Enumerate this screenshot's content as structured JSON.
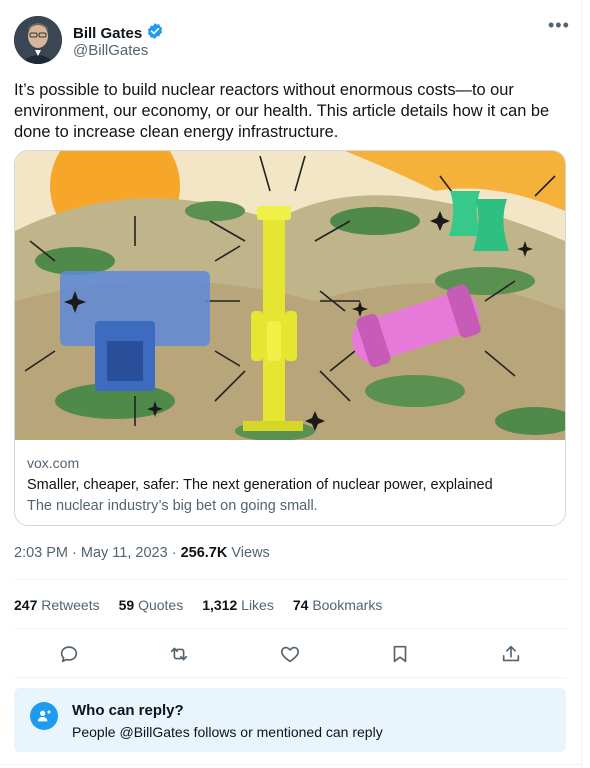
{
  "author": {
    "name": "Bill Gates",
    "handle": "@BillGates",
    "verified_color": "#1d9bf0"
  },
  "tweet": {
    "text": "It’s possible to build nuclear reactors without enormous costs—to our environment, our economy, or our health. This article details how it can be done to increase clean energy infrastructure."
  },
  "card": {
    "image_icon": "nuclear-reactors-illustration",
    "domain": "vox.com",
    "title": "Smaller, cheaper, safer: The next generation of nuclear power, explained",
    "description": "The nuclear industry’s big bet on going small."
  },
  "meta": {
    "time": "2:03 PM",
    "date": "May 11, 2023",
    "views_count": "256.7K",
    "views_label": "Views"
  },
  "stats": [
    {
      "count": "247",
      "label": "Retweets"
    },
    {
      "count": "59",
      "label": "Quotes"
    },
    {
      "count": "1,312",
      "label": "Likes"
    },
    {
      "count": "74",
      "label": "Bookmarks"
    }
  ],
  "actions": [
    "reply-icon",
    "retweet-icon",
    "like-icon",
    "bookmark-icon",
    "share-icon"
  ],
  "reply_restriction": {
    "title": "Who can reply?",
    "subtitle": "People @BillGates follows or mentioned can reply"
  },
  "colors": {
    "accent": "#1d9bf0",
    "secondary_text": "#536471",
    "reply_box_bg": "#e8f5fd"
  }
}
